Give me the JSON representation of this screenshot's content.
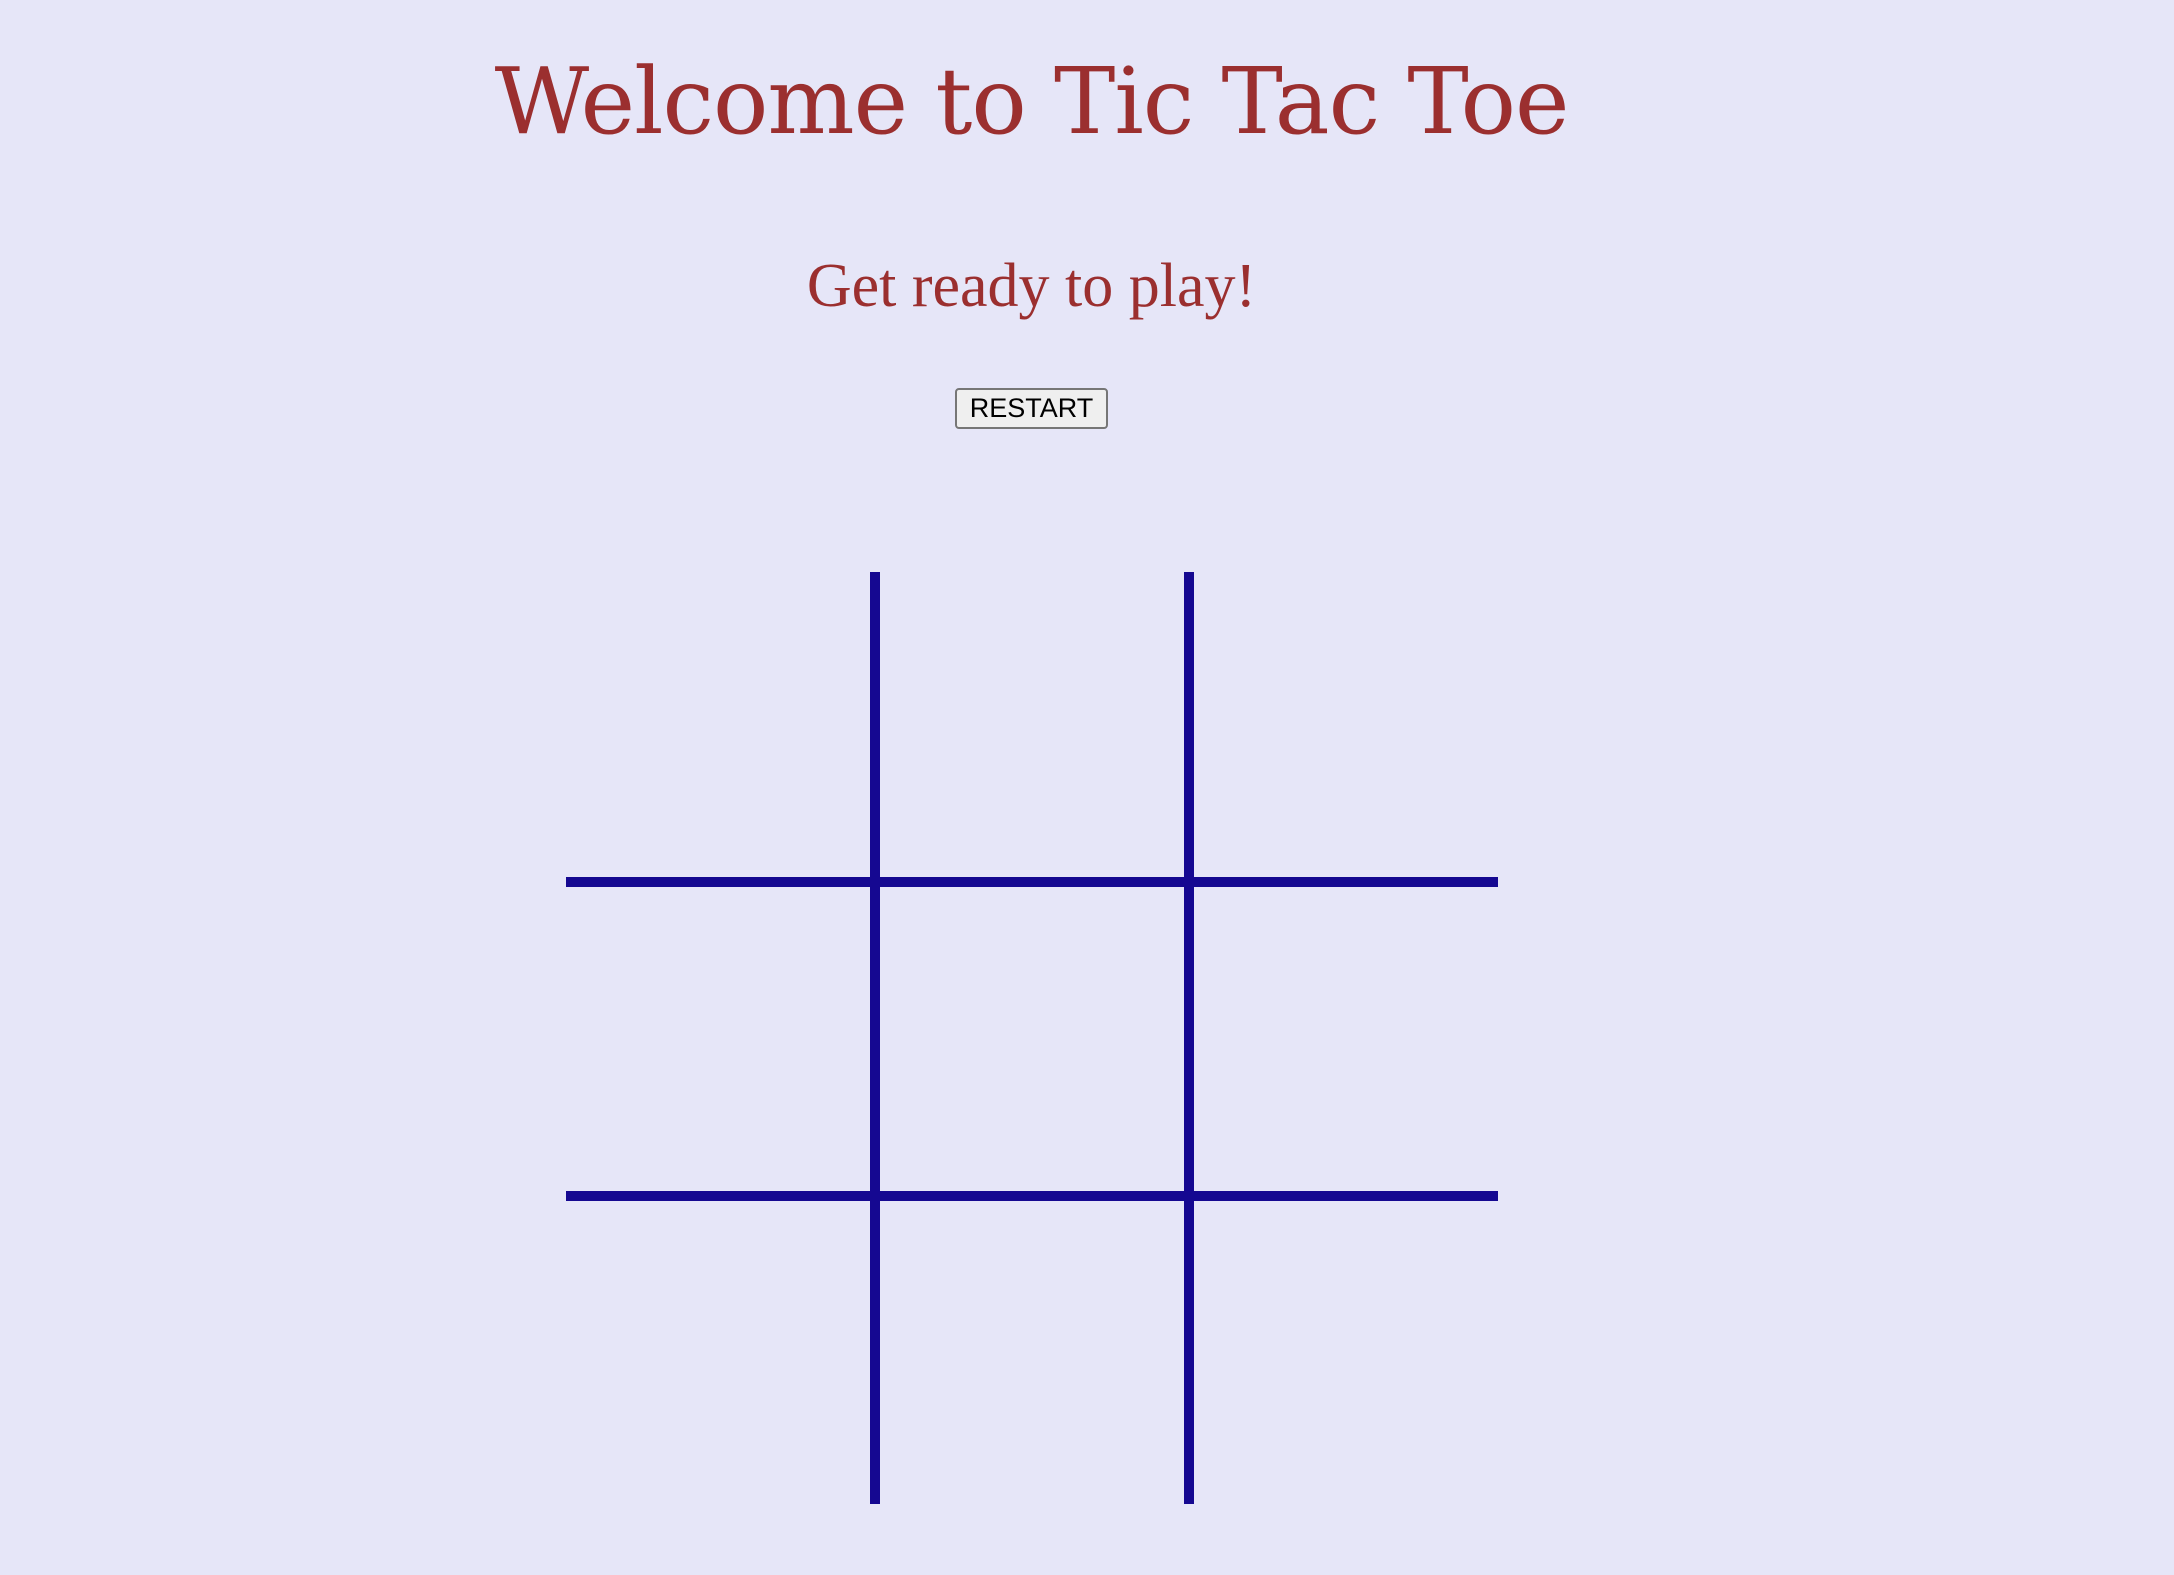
{
  "header": {
    "title": "Welcome to Tic Tac Toe",
    "status": "Get ready to play!"
  },
  "controls": {
    "restart_label": "RESTART"
  },
  "board": {
    "cells": [
      "",
      "",
      "",
      "",
      "",
      "",
      "",
      "",
      ""
    ],
    "line_color": "#150891"
  },
  "colors": {
    "background": "#e6e6f8",
    "heading": "#9b2f2f"
  }
}
